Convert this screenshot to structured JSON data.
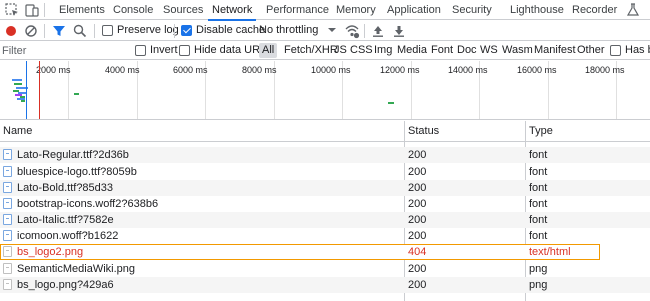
{
  "tabs": [
    {
      "label": "Elements"
    },
    {
      "label": "Console"
    },
    {
      "label": "Sources"
    },
    {
      "label": "Network"
    },
    {
      "label": "Performance"
    },
    {
      "label": "Memory"
    },
    {
      "label": "Application"
    },
    {
      "label": "Security"
    },
    {
      "label": "Lighthouse"
    },
    {
      "label": "Recorder"
    }
  ],
  "active_tab": "Network",
  "toolbar": {
    "preserve_log": "Preserve log",
    "preserve_log_checked": false,
    "disable_cache": "Disable cache",
    "disable_cache_checked": true,
    "throttling": "No throttling"
  },
  "filter": {
    "placeholder": "Filter",
    "invert": "Invert",
    "hide_data_urls": "Hide data URLs",
    "types": [
      "All",
      "Fetch/XHR",
      "JS",
      "CSS",
      "Img",
      "Media",
      "Font",
      "Doc",
      "WS",
      "Wasm",
      "Manifest",
      "Other"
    ],
    "active_type": "All",
    "has_blocked": "Has bl"
  },
  "overview": {
    "ticks": [
      "2000 ms",
      "4000 ms",
      "6000 ms",
      "8000 ms",
      "10000 ms",
      "12000 ms",
      "14000 ms",
      "16000 ms",
      "18000 ms"
    ]
  },
  "table": {
    "columns": {
      "name": "Name",
      "status": "Status",
      "type": "Type"
    },
    "rows": [
      {
        "name": "Lato-Regular.ttf?2d36b",
        "status": "200",
        "type": "font",
        "icon": "font-file-icon"
      },
      {
        "name": "bluespice-logo.ttf?8059b",
        "status": "200",
        "type": "font",
        "icon": "font-file-icon"
      },
      {
        "name": "Lato-Bold.ttf?85d33",
        "status": "200",
        "type": "font",
        "icon": "font-file-icon"
      },
      {
        "name": "bootstrap-icons.woff2?638b6",
        "status": "200",
        "type": "font",
        "icon": "font-file-icon"
      },
      {
        "name": "Lato-Italic.ttf?7582e",
        "status": "200",
        "type": "font",
        "icon": "font-file-icon"
      },
      {
        "name": "icomoon.woff?b1622",
        "status": "200",
        "type": "font",
        "icon": "font-file-icon"
      },
      {
        "name": "bs_logo2.png",
        "status": "404",
        "type": "text/html",
        "icon": "blank-file-icon",
        "error": true
      },
      {
        "name": "SemanticMediaWiki.png",
        "status": "200",
        "type": "png",
        "icon": "image-file-icon"
      },
      {
        "name": "bs_logo.png?429a6",
        "status": "200",
        "type": "png",
        "icon": "image-file-icon"
      }
    ]
  },
  "colors": {
    "accent": "#1a73e8",
    "error": "#d93025",
    "highlight_outline": "#f29900"
  }
}
